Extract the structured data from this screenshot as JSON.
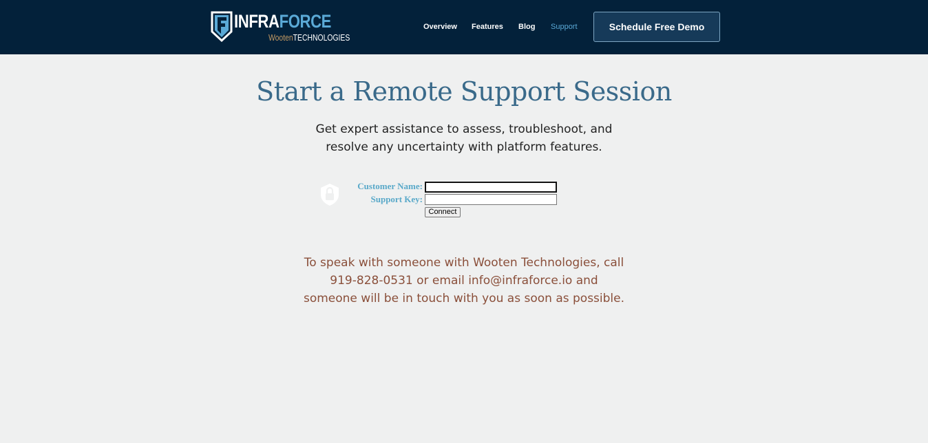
{
  "brand": {
    "word_part1": "INFRA",
    "word_part2": "FORCE",
    "sub_part1": "Wooten",
    "sub_part2": "TECHNOLOGIES",
    "accent_color": "#5aa9d6",
    "gold_color": "#c49a63"
  },
  "nav": {
    "items": [
      {
        "label": "Overview",
        "active": false
      },
      {
        "label": "Features",
        "active": false
      },
      {
        "label": "Blog",
        "active": false
      },
      {
        "label": "Support",
        "active": true
      }
    ],
    "cta_label": "Schedule Free Demo"
  },
  "main": {
    "title": "Start a Remote Support Session",
    "subtitle_line1": "Get expert assistance to assess, troubleshoot, and",
    "subtitle_line2": "resolve any uncertainty with platform features."
  },
  "form": {
    "icon": "shield-lock-icon",
    "customer_name_label": "Customer Name:",
    "customer_name_value": "",
    "support_key_label": "Support Key:",
    "support_key_value": "",
    "connect_label": "Connect"
  },
  "contact": {
    "line1": "To speak with someone with Wooten Technologies, call",
    "line2": "919-828-0531 or email info@infraforce.io and",
    "line3": "someone will be in touch with you as soon as possible."
  },
  "colors": {
    "header_bg": "#03213a",
    "page_bg": "#eff0f0",
    "title": "#3a6a8a",
    "contact_text": "#8a4f3a",
    "form_label": "#5aa9c9"
  }
}
